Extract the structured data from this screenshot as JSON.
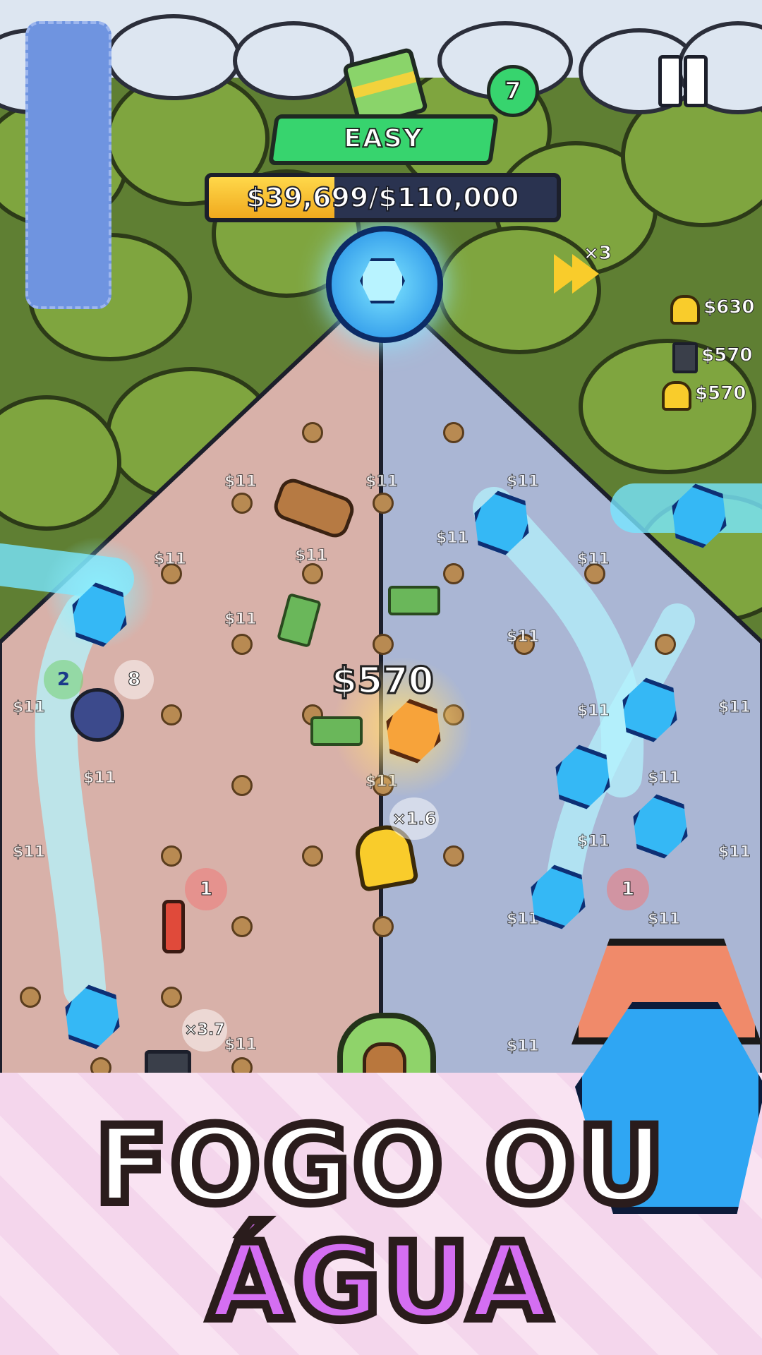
{
  "hud": {
    "difficulty": "EASY",
    "money_progress": "$39,699/$110,000",
    "money_current": 39699,
    "money_target": 110000,
    "flame_count": "7",
    "speed_multiplier": "×3"
  },
  "feed": [
    {
      "icon": "bell-icon",
      "amount": "$630"
    },
    {
      "icon": "trash-can-icon",
      "amount": "$570"
    },
    {
      "icon": "bell-icon",
      "amount": "$570"
    }
  ],
  "board": {
    "payout_popup": "$570",
    "peg_value": "$11",
    "bomb_hits": "2",
    "bomb_counter": "8",
    "bell_multiplier": "×1.6",
    "left_counter": "1",
    "right_counter": "1",
    "can_multiplier": "×3.7"
  },
  "promo": {
    "line1": "FOGO OU",
    "line2": "ÁGUA"
  },
  "colors": {
    "fire_side": "#d8b1a9",
    "water_side": "#aab6d4",
    "accent_green": "#37d46e",
    "progress_fill": "#f0a91e",
    "gem_blue": "#35b8f5"
  }
}
